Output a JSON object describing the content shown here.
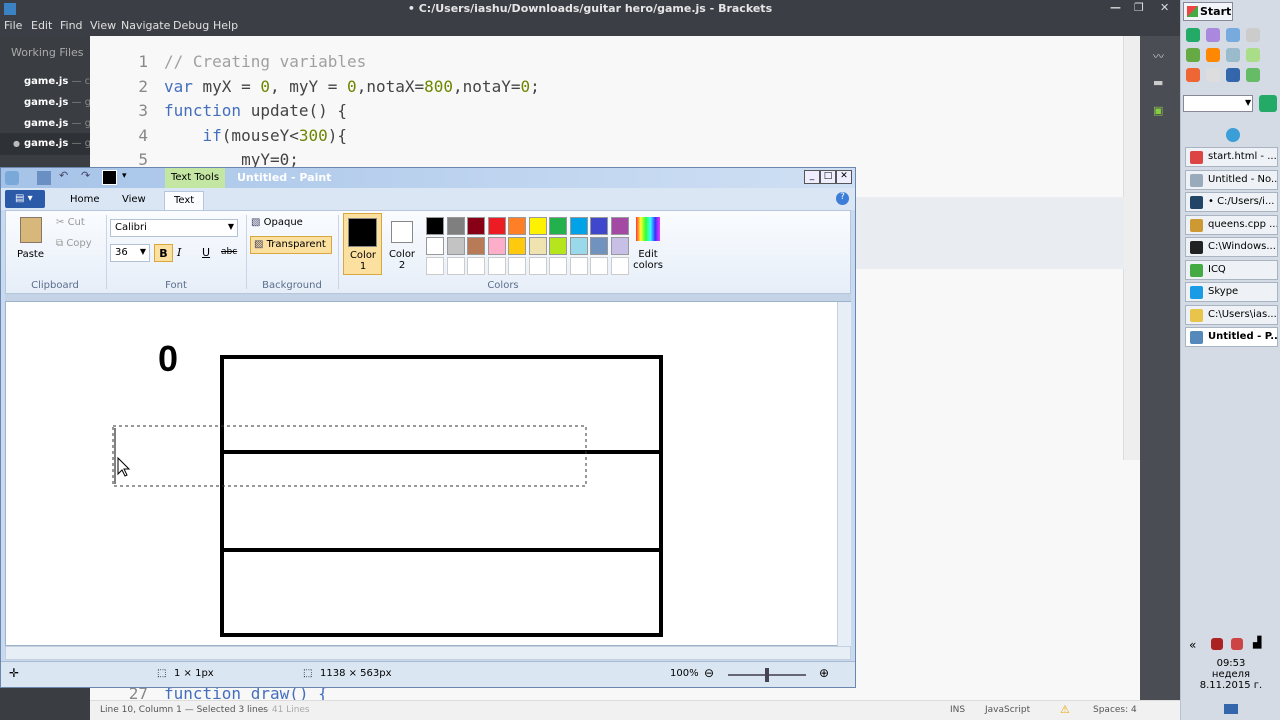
{
  "brackets": {
    "title": "• C:/Users/iashu/Downloads/guitar hero/game.js - Brackets",
    "menu": [
      "File",
      "Edit",
      "Find",
      "View",
      "Navigate",
      "Debug",
      "Help"
    ],
    "working_files_label": "Working Files",
    "working_files": [
      {
        "name": "game.js",
        "suffix": " — cod"
      },
      {
        "name": "game.js",
        "suffix": " — gui"
      },
      {
        "name": "game.js",
        "suffix": " — gui"
      },
      {
        "name": "game.js",
        "suffix": " — g"
      }
    ],
    "code_lines": [
      {
        "num": "1",
        "text": "// Creating variables"
      },
      {
        "num": "2",
        "text": "var myX = 0, myY = 0,notaX=800,notaY=0;"
      },
      {
        "num": "3",
        "text": "function update() {"
      },
      {
        "num": "4",
        "text": "    if(mouseY<300){"
      },
      {
        "num": "5",
        "text": "        myY=0;"
      }
    ],
    "hidden_line": {
      "num": "27",
      "text": "function draw() {"
    },
    "status": {
      "position": "Line 10, Column 1 — Selected 3 lines",
      "lines": "— 41 Lines",
      "ins": "INS",
      "language": "JavaScript",
      "spaces": "Spaces: 4"
    },
    "colors": {
      "keyword": "#446fbd",
      "number": "#6d8600",
      "comment": "#a0a0a0"
    }
  },
  "taskbar": {
    "start_label": "Start",
    "windows": [
      {
        "label": "start.html - ...",
        "color": "#d44"
      },
      {
        "label": "Untitled - No...",
        "color": "#9ab"
      },
      {
        "label": "• C:/Users/i...",
        "color": "#246"
      },
      {
        "label": "queens.cpp ...",
        "color": "#c93"
      },
      {
        "label": "C:\\Windows...",
        "color": "#222"
      },
      {
        "label": "ICQ",
        "color": "#4a4"
      },
      {
        "label": "Skype",
        "color": "#1a9be6"
      },
      {
        "label": "C:\\Users\\ias...",
        "color": "#e8c44a"
      },
      {
        "label": "Untitled - P...",
        "color": "#58b"
      }
    ],
    "clock": {
      "time": "09:53",
      "day": "неделя",
      "date": "8.11.2015 г."
    }
  },
  "paint": {
    "title": "Untitled - Paint",
    "context_tab": "Text Tools",
    "tabs": [
      "Home",
      "View",
      "Text"
    ],
    "clipboard": {
      "paste": "Paste",
      "cut": "Cut",
      "copy": "Copy",
      "label": "Clipboard"
    },
    "font": {
      "family": "Calibri",
      "size": "36",
      "label": "Font"
    },
    "background": {
      "opaque": "Opaque",
      "transparent": "Transparent",
      "label": "Background"
    },
    "color1": "Color 1",
    "color2": "Color 2",
    "colors_label": "Colors",
    "edit_colors": "Edit colors",
    "palette": [
      "#000000",
      "#7f7f7f",
      "#880015",
      "#ed1c24",
      "#ff7f27",
      "#fff200",
      "#22b14c",
      "#00a2e8",
      "#3f48cc",
      "#a349a4",
      "#ffffff",
      "#c3c3c3",
      "#b97a57",
      "#ffaec9",
      "#ffc90e",
      "#efe4b0",
      "#b5e61d",
      "#99d9ea",
      "#7092be",
      "#c8bfe7"
    ],
    "canvas_text": "0",
    "status": {
      "cursor": "1 × 1px",
      "size": "1138 × 563px",
      "zoom": "100%"
    }
  }
}
